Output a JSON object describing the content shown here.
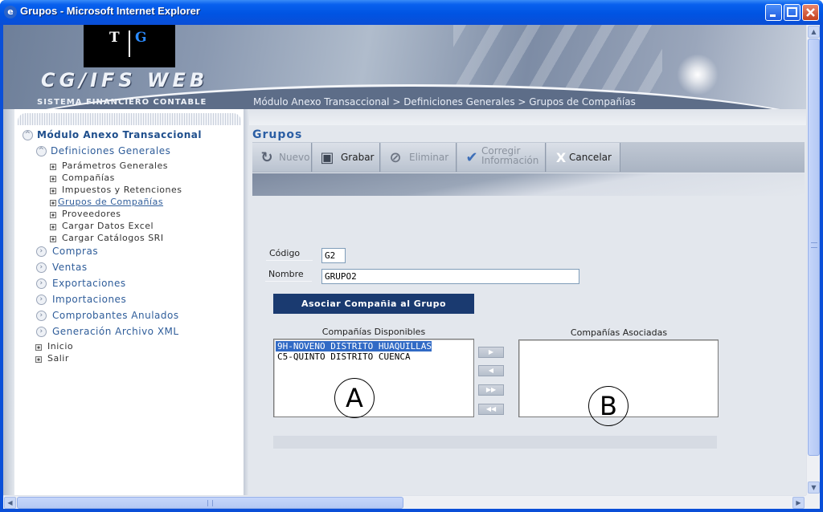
{
  "window": {
    "title": "Grupos - Microsoft Internet Explorer",
    "icon": "ie-icon",
    "minimize_label": "_",
    "maximize_label": "□",
    "close_label": "✕"
  },
  "header": {
    "logo": {
      "t": "T",
      "g": "G"
    },
    "brand": "CG/IFS  WEB",
    "brand_sub": "SISTEMA FINANCIERO CONTABLE",
    "breadcrumb": "Módulo Anexo Transaccional > Definiciones Generales > Grupos de Compañías"
  },
  "sidebar": {
    "module": "Módulo Anexo Transaccional",
    "section": "Definiciones Generales",
    "sub_items": [
      "Parámetros Generales",
      "Compañías",
      "Impuestos y Retenciones",
      "Grupos de Compañías",
      "Proveedores",
      "Cargar Datos Excel",
      "Cargar Catálogos SRI"
    ],
    "active_item": "Grupos de Compañías",
    "sections": [
      "Compras",
      "Ventas",
      "Exportaciones",
      "Importaciones",
      "Comprobantes Anulados",
      "Generación Archivo XML"
    ],
    "bottom": [
      "Inicio",
      "Salir"
    ]
  },
  "page": {
    "title": "Grupos",
    "toolbar": {
      "nuevo": "Nuevo",
      "grabar": "Grabar",
      "eliminar": "Eliminar",
      "corregir_1": "Corregir",
      "corregir_2": "Información",
      "cancelar": "Cancelar"
    },
    "form": {
      "codigo_label": "Código",
      "codigo_value": "G2",
      "nombre_label": "Nombre",
      "nombre_value": "GRUPO2",
      "assoc_button": "Asociar Compañia al Grupo"
    },
    "available": {
      "label": "Compañías Disponibles",
      "items": [
        "9H-NOVENO DISTRITO HUAQUILLAS",
        "C5-QUINTO DISTRITO CUENCA"
      ],
      "selected_index": 0
    },
    "associated": {
      "label": "Compañías Asociadas",
      "items": []
    },
    "move_buttons": [
      "▶",
      "◀",
      "▶▶",
      "◀◀"
    ],
    "annotations": {
      "a": "A",
      "b": "B"
    }
  }
}
